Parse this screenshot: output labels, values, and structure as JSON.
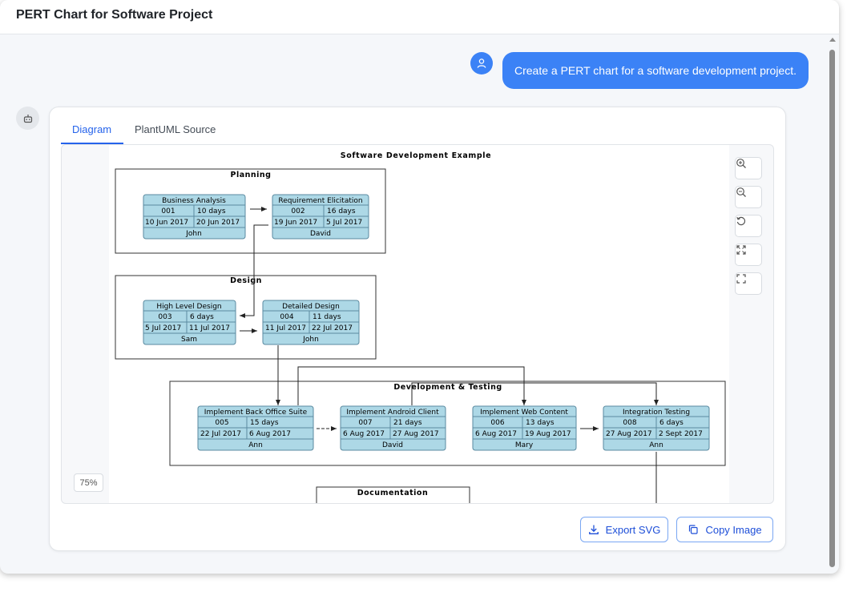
{
  "window": {
    "title": "PERT Chart for Software Project"
  },
  "user_message": {
    "text": "Create a PERT chart for a software development project."
  },
  "tabs": [
    {
      "label": "Diagram",
      "active": true
    },
    {
      "label": "PlantUML Source",
      "active": false
    }
  ],
  "diagram": {
    "title": "Software Development Example",
    "groups": {
      "planning": "Planning",
      "design": "Design",
      "dev": "Development & Testing",
      "doc": "Documentation"
    },
    "tasks": {
      "t001": {
        "name": "Business Analysis",
        "id": "001",
        "duration": "10 days",
        "start": "10 Jun 2017",
        "end": "20 Jun 2017",
        "owner": "John"
      },
      "t002": {
        "name": "Requirement Elicitation",
        "id": "002",
        "duration": "16 days",
        "start": "19 Jun 2017",
        "end": "5 Jul 2017",
        "owner": "David"
      },
      "t003": {
        "name": "High Level Design",
        "id": "003",
        "duration": "6 days",
        "start": "5 Jul 2017",
        "end": "11 Jul 2017",
        "owner": "Sam"
      },
      "t004": {
        "name": "Detailed Design",
        "id": "004",
        "duration": "11 days",
        "start": "11 Jul 2017",
        "end": "22 Jul 2017",
        "owner": "John"
      },
      "t005": {
        "name": "Implement Back Office Suite",
        "id": "005",
        "duration": "15 days",
        "start": "22 Jul 2017",
        "end": "6 Aug 2017",
        "owner": "Ann"
      },
      "t007": {
        "name": "Implement Android Client",
        "id": "007",
        "duration": "21 days",
        "start": "6 Aug 2017",
        "end": "27 Aug 2017",
        "owner": "David"
      },
      "t006": {
        "name": "Implement Web Content",
        "id": "006",
        "duration": "13 days",
        "start": "6 Aug 2017",
        "end": "19 Aug 2017",
        "owner": "Mary"
      },
      "t008": {
        "name": "Integration Testing",
        "id": "008",
        "duration": "6 days",
        "start": "27 Aug 2017",
        "end": "2 Sept 2017",
        "owner": "Ann"
      }
    }
  },
  "zoom": {
    "level": "75%"
  },
  "toolbar": {
    "icons": [
      "zoom-in-icon",
      "zoom-out-icon",
      "reset-icon",
      "fit-icon",
      "fullscreen-icon"
    ]
  },
  "actions": {
    "export_label": "Export SVG",
    "copy_label": "Copy Image"
  },
  "colors": {
    "accent": "#3b82f6",
    "task_fill": "#add8e6",
    "link": "#2563eb"
  }
}
